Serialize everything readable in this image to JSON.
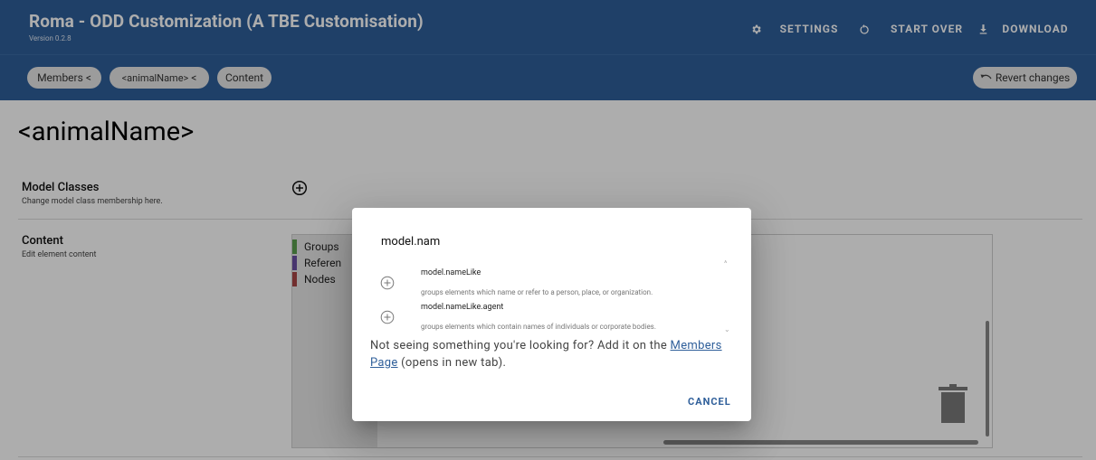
{
  "app": {
    "title": "Roma - ODD Customization (A TBE Customisation)",
    "version": "Version 0.2.8"
  },
  "toolbar": {
    "settings_label": "SETTINGS",
    "start_over_label": "START OVER",
    "download_label": "DOWNLOAD"
  },
  "breadcrumbs": {
    "members": "Members",
    "element": "<animalName>",
    "content": "Content",
    "revert": "Revert changes"
  },
  "page": {
    "title": "<animalName>",
    "model_classes": {
      "title": "Model Classes",
      "description": "Change model class membership here."
    },
    "content": {
      "title": "Content",
      "description": "Edit element content",
      "palette": [
        {
          "label": "Groups",
          "color": "#5a9e4d"
        },
        {
          "label": "Referen",
          "color": "#6a4fa3"
        },
        {
          "label": "Nodes",
          "color": "#a84646"
        }
      ]
    }
  },
  "dialog": {
    "search_value": "model.nam",
    "options": [
      {
        "name": "model.nameLike",
        "description": "groups elements which name or refer to a person, place, or organization."
      },
      {
        "name": "model.nameLike.agent",
        "description": "groups elements which contain names of individuals or corporate bodies."
      }
    ],
    "help_prefix": "Not seeing something you're looking for? Add it on the",
    "help_link": "Members Page",
    "help_suffix": "(opens in new tab).",
    "cancel_label": "CANCEL"
  }
}
